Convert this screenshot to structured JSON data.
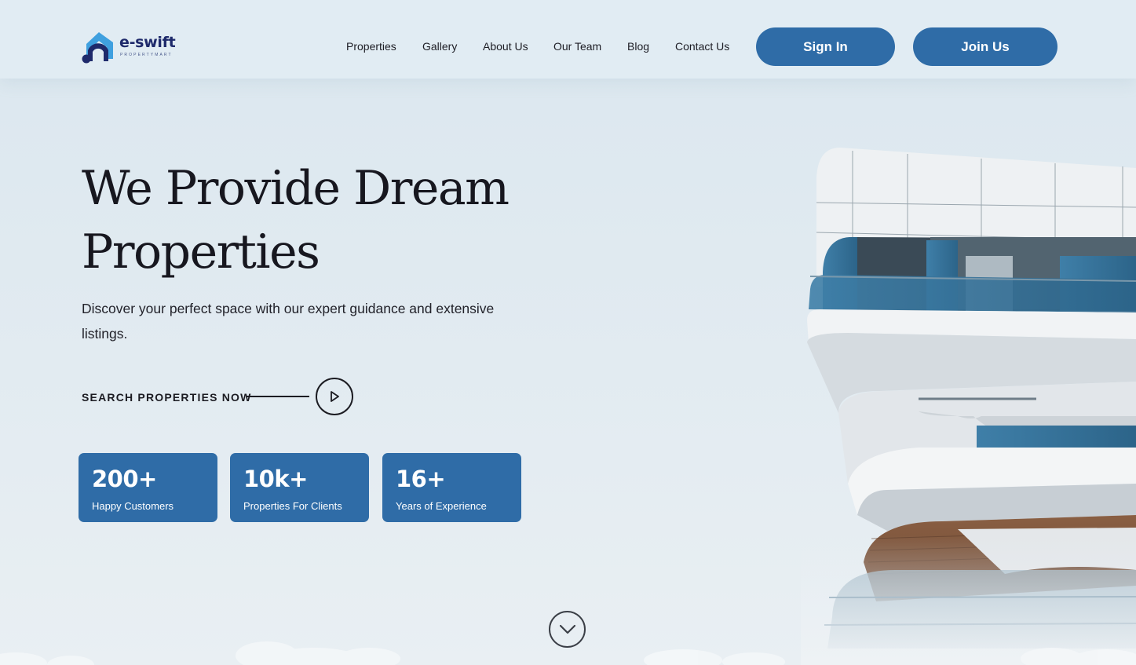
{
  "brand": {
    "name": "e-swift",
    "tagline": "PROPERTYMART",
    "colors": {
      "primary": "#2f6ca7",
      "navy": "#1e2a6b",
      "light_blue": "#3fa0df"
    }
  },
  "nav": {
    "items": [
      "Properties",
      "Gallery",
      "About Us",
      "Our Team",
      "Blog",
      "Contact Us"
    ],
    "sign_in_label": "Sign In",
    "join_label": "Join Us"
  },
  "hero": {
    "title_line1": "We Provide Dream",
    "title_line2": "Properties",
    "subtitle": "Discover your perfect space with our expert guidance and extensive listings.",
    "cta_label": "SEARCH PROPERTIES NOW",
    "cta_icon": "play-icon"
  },
  "stats": [
    {
      "value": "200+",
      "label": "Happy Customers"
    },
    {
      "value": "10k+",
      "label": "Properties For Clients"
    },
    {
      "value": "16+",
      "label": "Years of Experience"
    }
  ],
  "scroll_icon": "chevron-down-icon"
}
